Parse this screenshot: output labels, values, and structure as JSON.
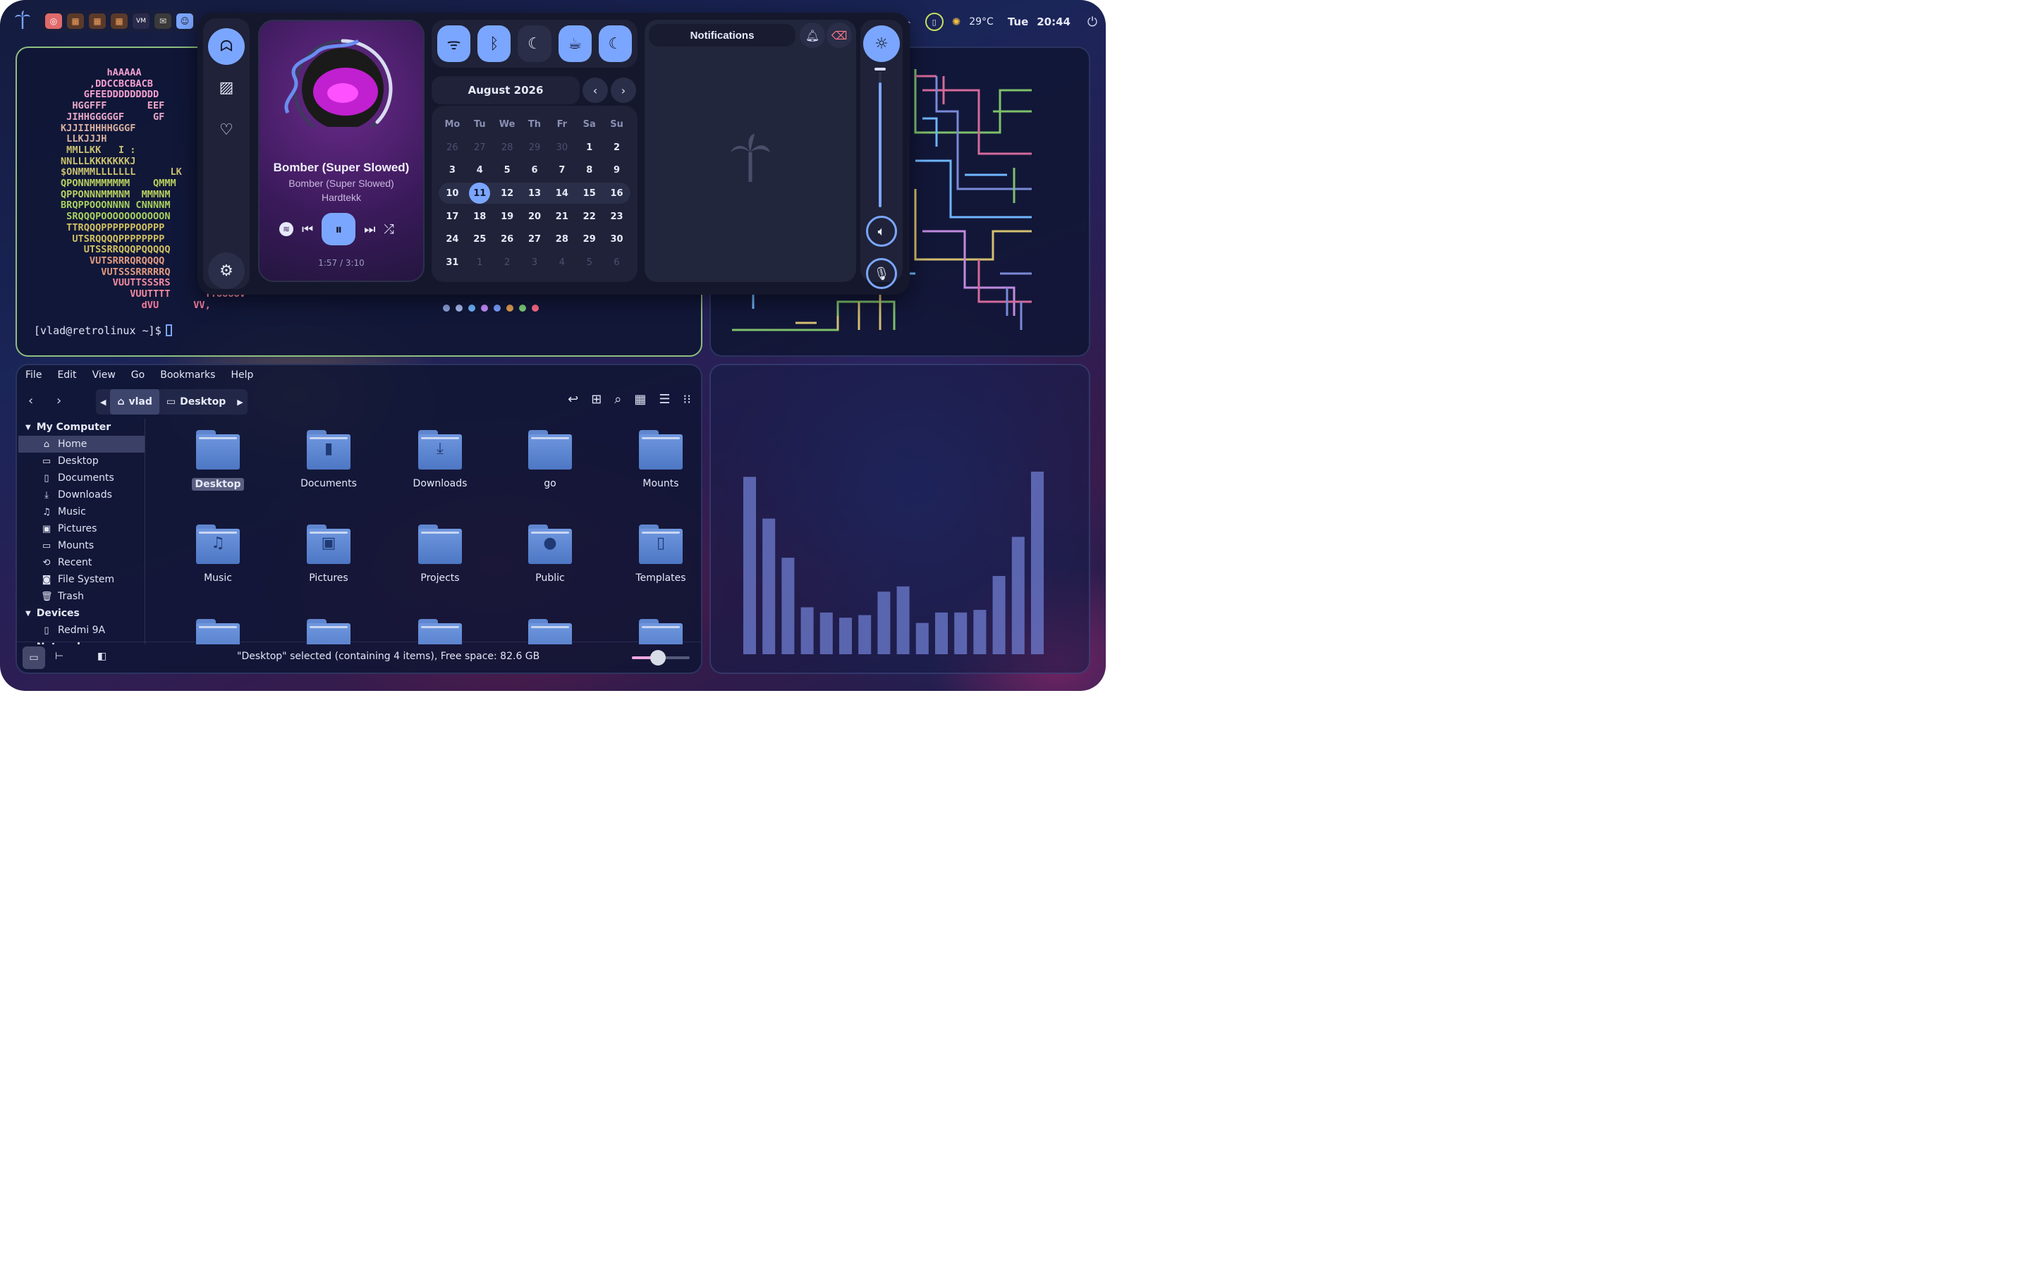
{
  "topbar": {
    "tray_icons": [
      "app-icon-1",
      "app-icon-2",
      "app-icon-3",
      "app-icon-4",
      "app-icon-5",
      "app-icon-6",
      "app-icon-7"
    ],
    "weather_temp": "29°C",
    "day": "Tue",
    "time": "20:44",
    "battery_icon": "battery-icon",
    "power_icon": "power-icon"
  },
  "terminal": {
    "ascii_lines": [
      "        hAAAAA",
      "     ,DDCCBCBACB",
      "    GFEEDDDDDDDDD",
      "  HGGFFF       EEF",
      " JIHHGGGGGF     GF",
      "KJJIIHHHHGGGF",
      " LLKJJJH",
      " MMLLKK   I :",
      "NNLLLKKKKKKKJ",
      "$ONMMMLLLLLLL      LK",
      "QPONNMMMMMMM    QMMM",
      "QPPONNNMMMNM  MMMNM",
      "BRQPPOOONNNN CNNNNM",
      " SRQQQPOOOOOOOOOOON",
      " TTRQQQPPPPPPOOPPP",
      "  UTSRQQQQPPPPPPPP",
      "    UTSSRRQQQPQQQQQ",
      "     VUTSRRRQRQQQQ",
      "       VUTSSSRRRRRQ",
      "         VUUTTSSSRS",
      "            VUUTTTT      TTUUUUV",
      "              dVU      VV,"
    ],
    "prompt": "[vlad@retrolinux ~]$"
  },
  "files": {
    "menu": [
      "File",
      "Edit",
      "View",
      "Go",
      "Bookmarks",
      "Help"
    ],
    "breadcrumb": [
      "vlad",
      "Desktop"
    ],
    "sidebar": {
      "my_computer": "My Computer",
      "items": [
        {
          "label": "Home",
          "icon": "home-icon"
        },
        {
          "label": "Desktop",
          "icon": "folder-icon"
        },
        {
          "label": "Documents",
          "icon": "document-icon"
        },
        {
          "label": "Downloads",
          "icon": "download-icon"
        },
        {
          "label": "Music",
          "icon": "music-icon"
        },
        {
          "label": "Pictures",
          "icon": "image-icon"
        },
        {
          "label": "Mounts",
          "icon": "folder-icon"
        },
        {
          "label": "Recent",
          "icon": "clock-icon"
        },
        {
          "label": "File System",
          "icon": "drive-icon"
        },
        {
          "label": "Trash",
          "icon": "trash-icon"
        }
      ],
      "devices": "Devices",
      "device_items": [
        {
          "label": "Redmi 9A",
          "icon": "phone-icon"
        }
      ],
      "network": "Network"
    },
    "folders": [
      {
        "label": "Desktop",
        "glyph": ""
      },
      {
        "label": "Documents",
        "glyph": "▮"
      },
      {
        "label": "Downloads",
        "glyph": "⤓"
      },
      {
        "label": "go",
        "glyph": ""
      },
      {
        "label": "Mounts",
        "glyph": ""
      },
      {
        "label": "Music",
        "glyph": "♫"
      },
      {
        "label": "Pictures",
        "glyph": "▣"
      },
      {
        "label": "Projects",
        "glyph": ""
      },
      {
        "label": "Public",
        "glyph": "●"
      },
      {
        "label": "Templates",
        "glyph": "▯"
      }
    ],
    "status": "\"Desktop\" selected (containing 4 items), Free space: 82.6 GB",
    "zoom_level": 0.45
  },
  "visualizer": {
    "bar_levels": [
      0.68,
      0.52,
      0.37,
      0.18,
      0.16,
      0.14,
      0.15,
      0.24,
      0.26,
      0.12,
      0.16,
      0.16,
      0.17,
      0.3,
      0.45,
      0.7
    ]
  },
  "control_center": {
    "player": {
      "title": "Bomber (Super Slowed)",
      "album": "Bomber (Super Slowed)",
      "artist": "Hardtekk",
      "time": "1:57 / 3:10",
      "progress": 0.62
    },
    "calendar": {
      "month": "August 2026",
      "weekdays": [
        "Mo",
        "Tu",
        "We",
        "Th",
        "Fr",
        "Sa",
        "Su"
      ],
      "weeks": [
        [
          "26",
          "27",
          "28",
          "29",
          "30",
          "1",
          "2"
        ],
        [
          "3",
          "4",
          "5",
          "6",
          "7",
          "8",
          "9"
        ],
        [
          "10",
          "11",
          "12",
          "13",
          "14",
          "15",
          "16"
        ],
        [
          "17",
          "18",
          "19",
          "20",
          "21",
          "22",
          "23"
        ],
        [
          "24",
          "25",
          "26",
          "27",
          "28",
          "29",
          "30"
        ],
        [
          "31",
          "1",
          "2",
          "3",
          "4",
          "5",
          "6"
        ]
      ],
      "today": "11"
    },
    "notifications_title": "Notifications",
    "volume_level": 0.92,
    "page_dot_colors": [
      "#8aa0d8",
      "#a8b8f0",
      "#6fb6ff",
      "#c78cff",
      "#7aa0ff",
      "#e0a050",
      "#7ed07a",
      "#ff6a8a"
    ]
  }
}
